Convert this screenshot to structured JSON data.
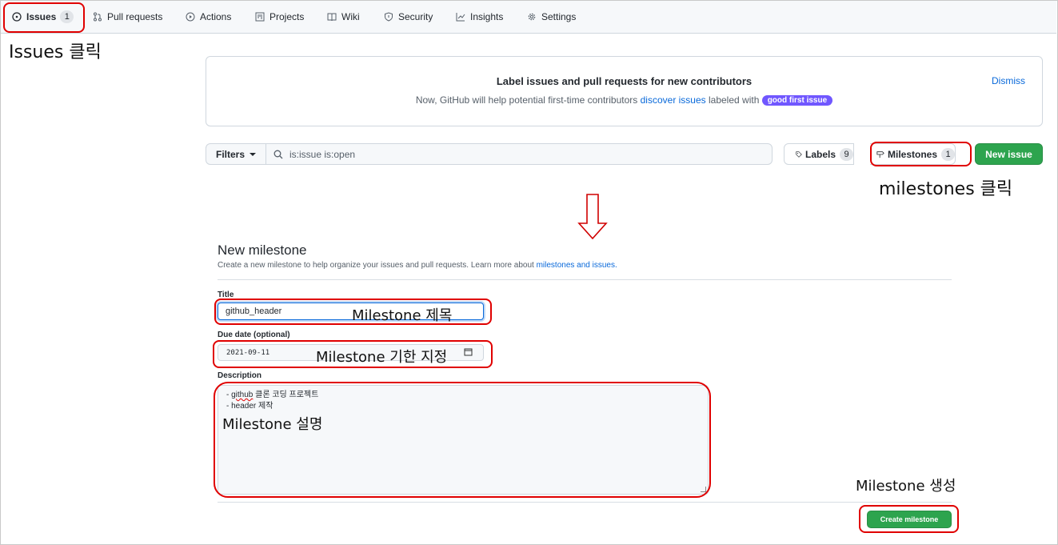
{
  "nav": {
    "issues": {
      "label": "Issues",
      "count": "1"
    },
    "pull_requests": "Pull requests",
    "actions": "Actions",
    "projects": "Projects",
    "wiki": "Wiki",
    "security": "Security",
    "insights": "Insights",
    "settings": "Settings"
  },
  "banner": {
    "title": "Label issues and pull requests for new contributors",
    "sub_prefix": "Now, GitHub will help potential first-time contributors ",
    "sub_link": "discover issues",
    "sub_suffix": " labeled with ",
    "badge": "good first issue",
    "dismiss": "Dismiss"
  },
  "toolbar": {
    "filters": "Filters",
    "search_value": "is:issue is:open",
    "labels": {
      "label": "Labels",
      "count": "9"
    },
    "milestones": {
      "label": "Milestones",
      "count": "1"
    },
    "new_issue": "New issue"
  },
  "form": {
    "heading": "New milestone",
    "description_prefix": "Create a new milestone to help organize your issues and pull requests. Learn more about ",
    "description_link": "milestones and issues.",
    "title_label": "Title",
    "title_value": "github_header",
    "due_label": "Due date (optional)",
    "due_value": "2021-09-11",
    "desc_label": "Description",
    "desc_lines": [
      "- github 클론 코딩 프로젝트",
      "- header 제작"
    ],
    "desc_first_word": "github",
    "create_button": "Create milestone"
  },
  "annotations": {
    "issues_click": "Issues 클릭",
    "milestones_click": "milestones 클릭",
    "title_note": "Milestone 제목",
    "due_note": "Milestone 기한 지정",
    "desc_note": "Milestone 설명",
    "create_note": "Milestone 생성"
  },
  "colors": {
    "annotation_red": "#e00000",
    "primary_green": "#2da44e",
    "link_blue": "#0969da",
    "gfi_purple": "#7057ff"
  }
}
